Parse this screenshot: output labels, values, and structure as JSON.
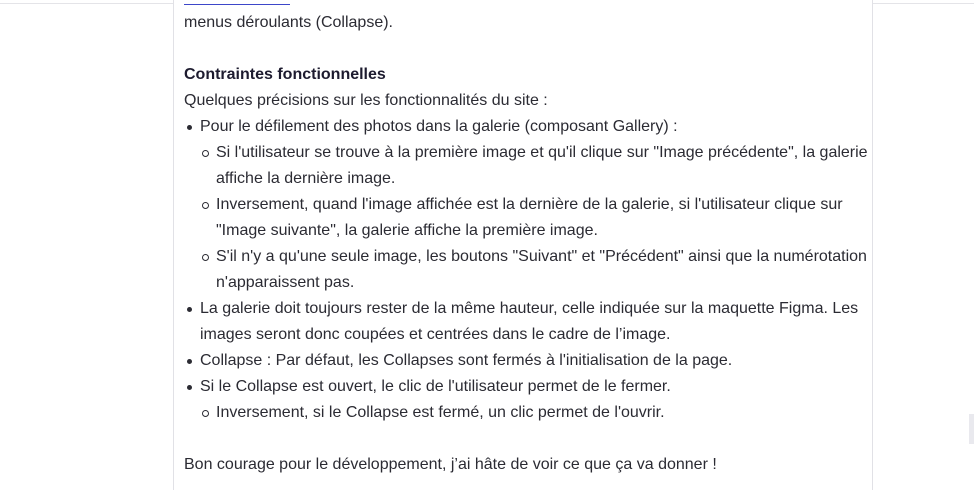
{
  "document": {
    "intro_tail": "menus déroulants (Collapse).",
    "heading": "Contraintes fonctionnelles",
    "lead": "Quelques précisions sur les fonctionnalités du site :",
    "bullets": [
      {
        "text": "Pour le défilement des photos dans la galerie (composant Gallery) :",
        "sub": [
          "Si l'utilisateur se trouve à la première image et qu'il clique sur \"Image précédente\", la galerie affiche la dernière image.",
          "Inversement, quand l'image affichée est la dernière de la galerie, si l'utilisateur clique sur \"Image suivante\", la galerie affiche la première image.",
          "S'il n'y a qu'une seule image, les boutons \"Suivant\" et \"Précédent\" ainsi que la numérotation n'apparaissent pas."
        ]
      },
      {
        "text": "La galerie doit toujours rester de la même hauteur, celle indiquée sur la maquette Figma. Les images seront donc coupées et centrées dans le cadre de l’image."
      },
      {
        "text": "Collapse : Par défaut, les Collapses sont fermés à l'initialisation de la page."
      },
      {
        "text": "Si le Collapse est ouvert, le clic de l'utilisateur permet de le fermer.",
        "sub": [
          "Inversement, si le Collapse est fermé, un clic permet de l'ouvrir."
        ]
      }
    ],
    "closing": "Bon courage pour le développement, j’ai hâte de voir ce que ça va donner !"
  },
  "colors": {
    "text": "#2b2b33",
    "heading": "#1d1b2f",
    "link": "#3d46c9",
    "border": "#e1e1e6"
  }
}
